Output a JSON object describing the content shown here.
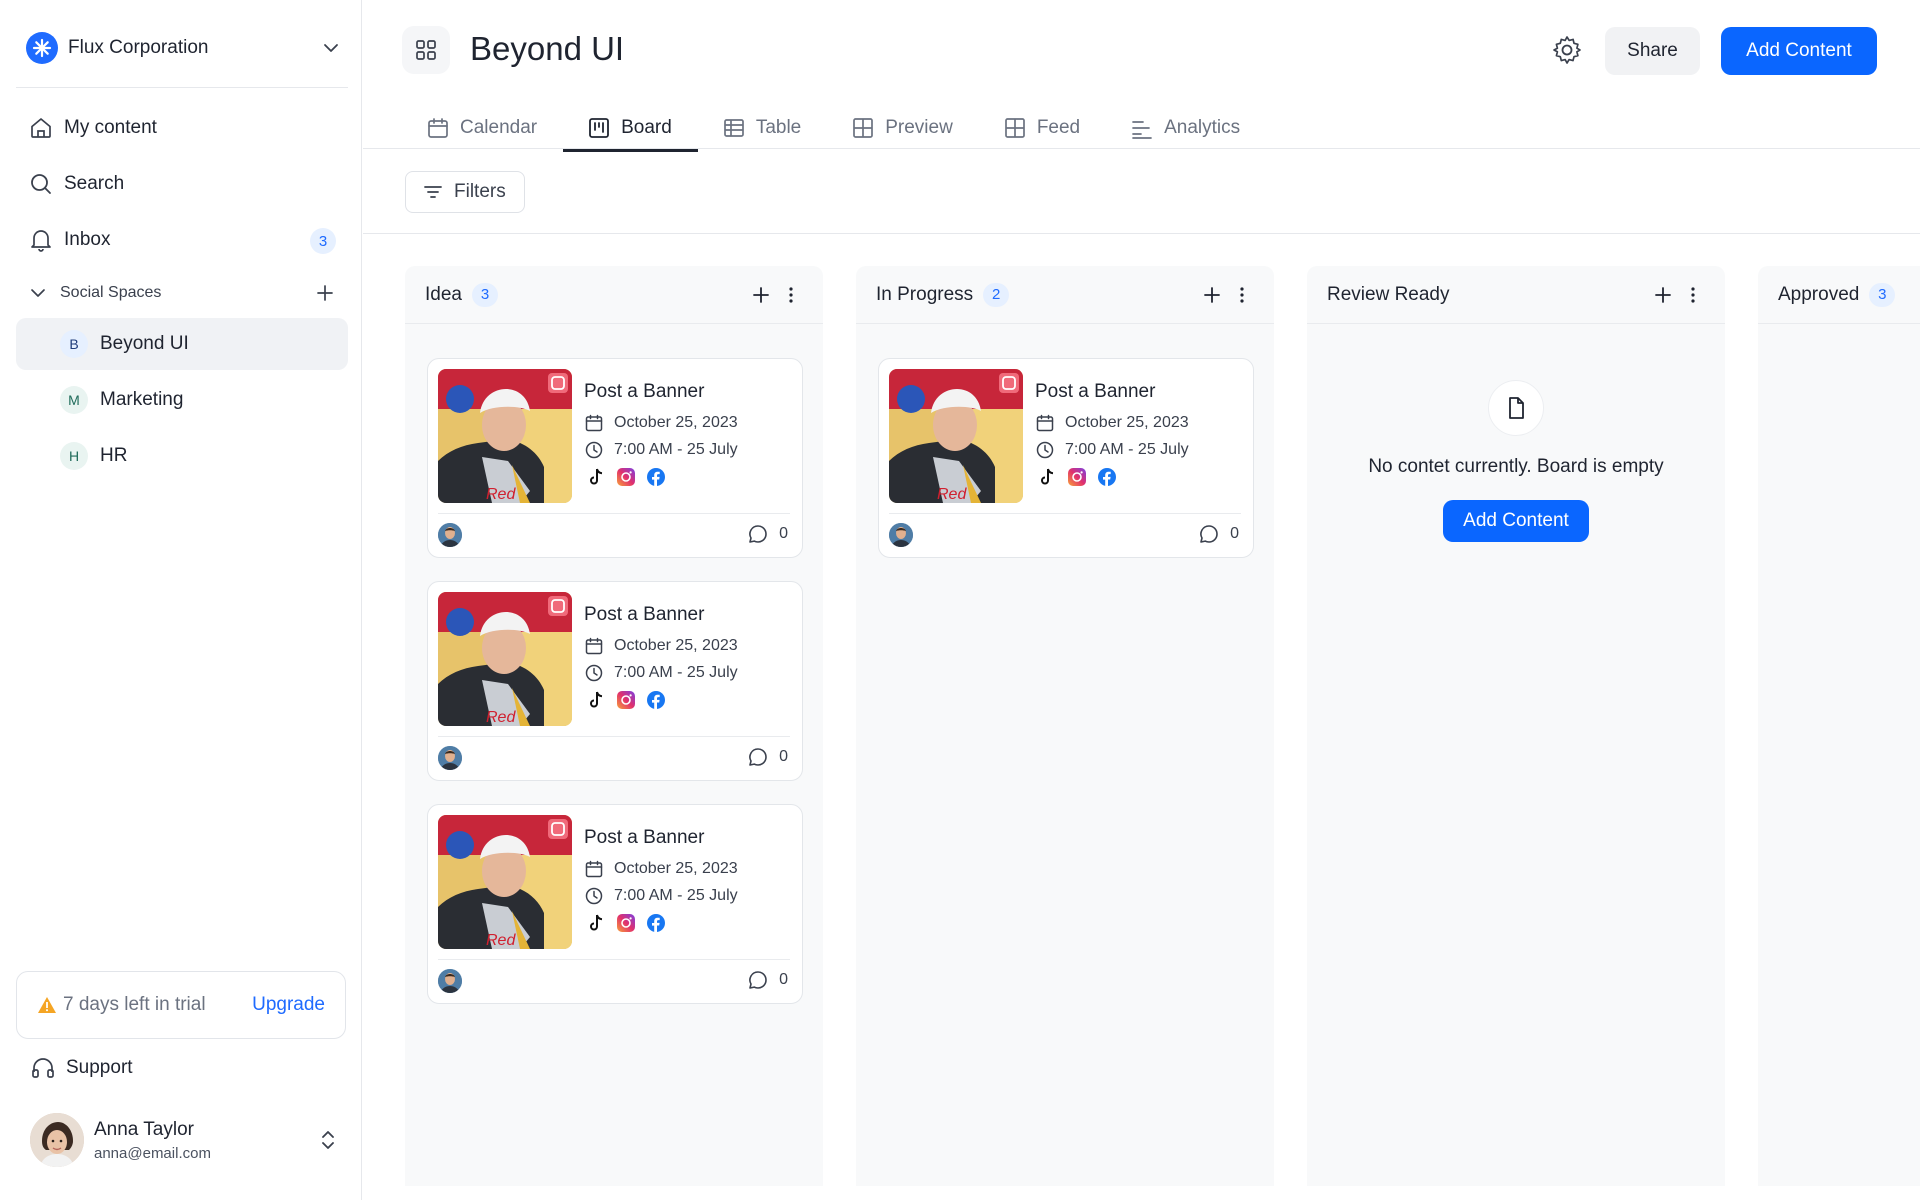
{
  "org": {
    "name": "Flux Corporation"
  },
  "nav": {
    "my_content": "My content",
    "search": "Search",
    "inbox": "Inbox",
    "inbox_count": "3"
  },
  "spaces": {
    "section_label": "Social Spaces",
    "items": [
      {
        "letter": "B",
        "label": "Beyond UI"
      },
      {
        "letter": "M",
        "label": "Marketing"
      },
      {
        "letter": "H",
        "label": "HR"
      }
    ]
  },
  "trial": {
    "text": "7 days left in trial",
    "upgrade": "Upgrade"
  },
  "support": "Support",
  "user": {
    "name": "Anna Taylor",
    "email": "anna@email.com"
  },
  "header": {
    "title": "Beyond UI",
    "share": "Share",
    "add_content": "Add Content"
  },
  "tabs": [
    "Calendar",
    "Board",
    "Table",
    "Preview",
    "Feed",
    "Analytics"
  ],
  "active_tab": "Board",
  "filters": "Filters",
  "colors": {
    "accent": "#0a66ff",
    "badge_bg": "#e6f0ff"
  },
  "columns": [
    {
      "title": "Idea",
      "count": "3"
    },
    {
      "title": "In Progress",
      "count": "2"
    },
    {
      "title": "Review Ready",
      "count": ""
    },
    {
      "title": "Approved",
      "count": "3"
    }
  ],
  "card": {
    "title": "Post a Banner",
    "date": "October 25, 2023",
    "time": "7:00 AM - 25 July",
    "comments": "0",
    "socials": [
      "tiktok-icon",
      "instagram-icon",
      "facebook-icon"
    ]
  },
  "empty": {
    "text": "No contet currently. Board is empty",
    "button": "Add Content"
  }
}
